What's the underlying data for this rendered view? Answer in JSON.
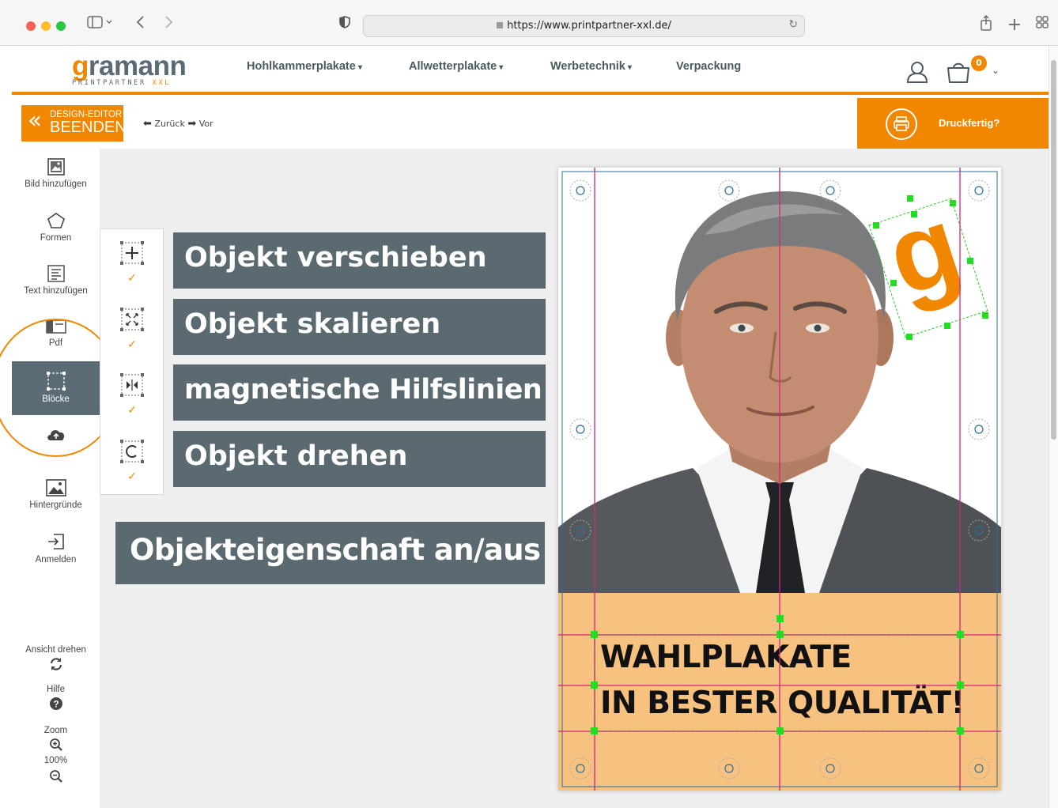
{
  "browser": {
    "url": "https://www.printpartner-xxl.de/",
    "icons": [
      "sidebar-toggle-icon",
      "back-icon",
      "forward-icon",
      "shield-icon",
      "lock-icon",
      "reload-icon",
      "share-icon",
      "new-tab-icon",
      "tab-overview-icon"
    ]
  },
  "header": {
    "logo": {
      "main_g": "g",
      "main_rest": "ramann",
      "sub": "PRINTPARTNER",
      "sub_accent": "XXL"
    },
    "nav": [
      {
        "label": "Hohlkammerplakate",
        "has_dropdown": true
      },
      {
        "label": "Allwetterplakate",
        "has_dropdown": true
      },
      {
        "label": "Werbetechnik",
        "has_dropdown": true
      },
      {
        "label": "Verpackung",
        "has_dropdown": false
      }
    ],
    "cart_count": "0"
  },
  "editor": {
    "end_button": {
      "line1": "DESIGN-EDITOR",
      "line2": "BEENDEN"
    },
    "undo_label": "Zurück",
    "redo_label": "Vor",
    "ready_label": "Druckfertig?"
  },
  "sidebar": {
    "items": [
      {
        "label": "Bild hinzufügen",
        "icon": "image-add-icon"
      },
      {
        "label": "Formen",
        "icon": "pentagon-icon"
      },
      {
        "label": "Text hinzufügen",
        "icon": "text-add-icon"
      },
      {
        "label": "Pdf",
        "icon": "pdf-icon"
      },
      {
        "label": "Blöcke",
        "icon": "blocks-icon",
        "active": true
      },
      {
        "label": "",
        "icon": "cloud-upload-icon"
      },
      {
        "label": "Hintergründe",
        "icon": "backgrounds-icon"
      },
      {
        "label": "Anmelden",
        "icon": "login-icon"
      }
    ],
    "bottom": {
      "rotate_label": "Ansicht drehen",
      "help_label": "Hilfe",
      "zoom_label": "Zoom",
      "zoom_value": "100%"
    }
  },
  "block_panel": {
    "items": [
      {
        "icon": "move-icon",
        "checked": true
      },
      {
        "icon": "scale-icon",
        "checked": true
      },
      {
        "icon": "magnet-guides-icon",
        "checked": true
      },
      {
        "icon": "rotate-icon",
        "checked": true
      }
    ]
  },
  "callouts": [
    "Objekt verschieben",
    "Objekt skalieren",
    "magnetische Hilfslinien",
    "Objekt drehen",
    "Objekteigenschaft an/aus"
  ],
  "poster": {
    "headline1": "WAHLPLAKATE",
    "headline2": "IN BESTER QUALITÄT!",
    "logo_letter": "g",
    "colors": {
      "band": "#f7c27f",
      "accent": "#f18700",
      "guides": "#d6247a",
      "handles": "#22dd22"
    }
  }
}
